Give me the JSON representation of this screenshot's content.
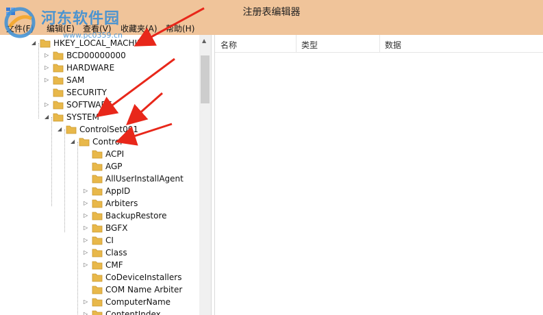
{
  "window": {
    "title": "注册表编辑器"
  },
  "menubar": {
    "items": [
      "文件(F)",
      "编辑(E)",
      "查看(V)",
      "收藏夹(A)",
      "帮助(H)"
    ]
  },
  "watermark": {
    "name": "河东软件园",
    "site": "www.pc0359.cn"
  },
  "list": {
    "columns": [
      "名称",
      "类型",
      "数据"
    ]
  },
  "tree": [
    {
      "label": "HKEY_LOCAL_MACHINE",
      "level": 0,
      "expander": "expanded"
    },
    {
      "label": "BCD00000000",
      "level": 1,
      "expander": "collapsed"
    },
    {
      "label": "HARDWARE",
      "level": 1,
      "expander": "collapsed"
    },
    {
      "label": "SAM",
      "level": 1,
      "expander": "collapsed"
    },
    {
      "label": "SECURITY",
      "level": 1,
      "expander": "none"
    },
    {
      "label": "SOFTWARE",
      "level": 1,
      "expander": "collapsed"
    },
    {
      "label": "SYSTEM",
      "level": 1,
      "expander": "expanded"
    },
    {
      "label": "ControlSet001",
      "level": 2,
      "expander": "expanded"
    },
    {
      "label": "Control",
      "level": 3,
      "expander": "expanded"
    },
    {
      "label": "ACPI",
      "level": 4,
      "expander": "none"
    },
    {
      "label": "AGP",
      "level": 4,
      "expander": "none"
    },
    {
      "label": "AllUserInstallAgent",
      "level": 4,
      "expander": "none"
    },
    {
      "label": "AppID",
      "level": 4,
      "expander": "collapsed"
    },
    {
      "label": "Arbiters",
      "level": 4,
      "expander": "collapsed"
    },
    {
      "label": "BackupRestore",
      "level": 4,
      "expander": "collapsed"
    },
    {
      "label": "BGFX",
      "level": 4,
      "expander": "collapsed"
    },
    {
      "label": "CI",
      "level": 4,
      "expander": "collapsed"
    },
    {
      "label": "Class",
      "level": 4,
      "expander": "collapsed"
    },
    {
      "label": "CMF",
      "level": 4,
      "expander": "collapsed"
    },
    {
      "label": "CoDeviceInstallers",
      "level": 4,
      "expander": "none"
    },
    {
      "label": "COM Name Arbiter",
      "level": 4,
      "expander": "none"
    },
    {
      "label": "ComputerName",
      "level": 4,
      "expander": "collapsed"
    },
    {
      "label": "ContentIndex",
      "level": 4,
      "expander": "collapsed"
    }
  ],
  "colors": {
    "titlebar": "#f0c49a",
    "folder": "#e8b84a",
    "arrow": "#e8271a",
    "watermark": "#3b8fd6"
  }
}
